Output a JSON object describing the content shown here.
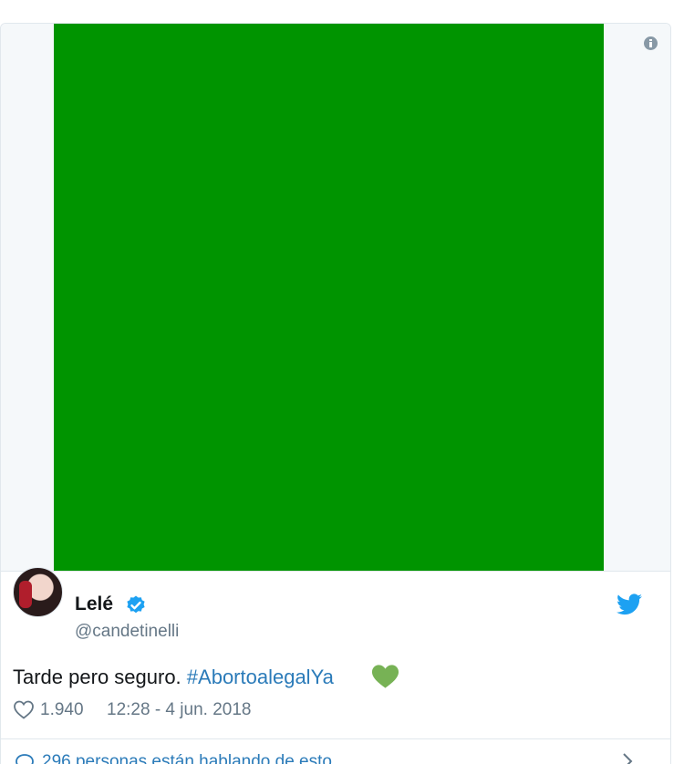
{
  "tweet": {
    "author": {
      "display_name": "Lelé",
      "handle": "@candetinelli",
      "verified": true
    },
    "text_prefix": "Tarde pero seguro.",
    "hashtag": "#AbortoalegalYa",
    "emoji": "green-heart",
    "likes": "1.940",
    "timestamp": "12:28 - 4 jun. 2018",
    "media_color": "#009400"
  },
  "conversation": {
    "label": "296 personas están hablando de esto"
  },
  "icons": [
    "info-icon",
    "verified-badge-icon",
    "twitter-bird-icon",
    "heart-outline-icon",
    "speech-bubble-icon",
    "chevron-right-icon",
    "green-heart-emoji"
  ],
  "colors": {
    "link": "#2b7bb9",
    "muted": "#657786",
    "twitter_blue": "#1da1f2"
  }
}
